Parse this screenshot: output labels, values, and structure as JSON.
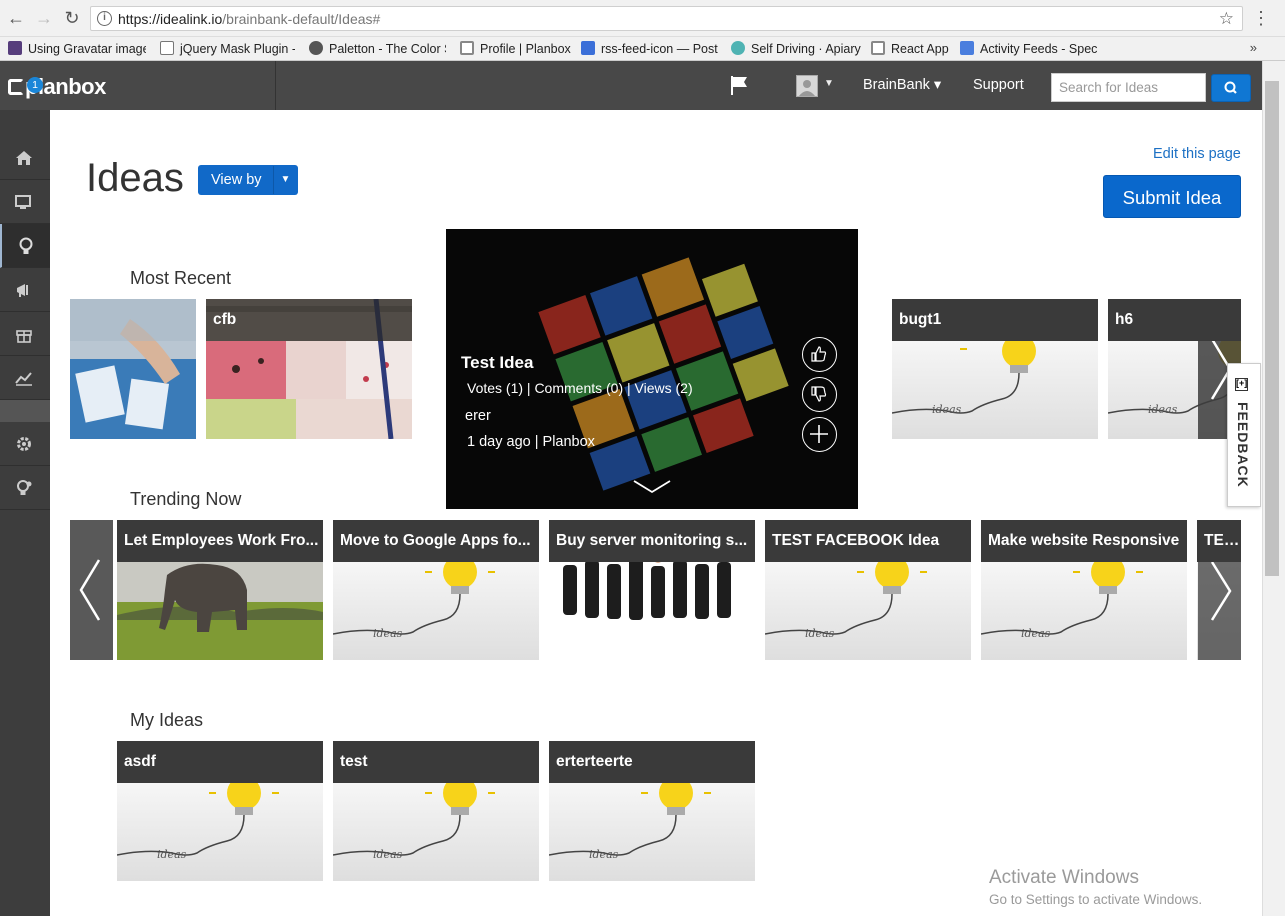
{
  "browser": {
    "url_host": "https://idealink.io",
    "url_path": "/brainbank-default/Ideas#",
    "bookmarks": [
      {
        "label": "Using Gravatar image",
        "icon": "bootstrap-icon",
        "color": "#563d7c"
      },
      {
        "label": "jQuery Mask Plugin -",
        "icon": "page-icon",
        "color": "#ffffff"
      },
      {
        "label": "Paletton - The Color S",
        "icon": "paletton-icon",
        "color": "#555555"
      },
      {
        "label": "Profile | Planbox",
        "icon": "planbox-icon",
        "color": "#888888"
      },
      {
        "label": "rss-feed-icon — Postr",
        "icon": "postr-icon",
        "color": "#3b6fd8"
      },
      {
        "label": "Self Driving · Apiary",
        "icon": "apiary-icon",
        "color": "#4fb3b3"
      },
      {
        "label": "React App",
        "icon": "react-icon",
        "color": "#888888"
      },
      {
        "label": "Activity Feeds - Speci",
        "icon": "docs-icon",
        "color": "#4a7ede"
      }
    ],
    "more": "»"
  },
  "header": {
    "logo": "planbox",
    "brainbank": "BrainBank ▾",
    "support": "Support",
    "search_placeholder": "Search for Ideas"
  },
  "sidebar": {
    "badge_count": "1"
  },
  "main": {
    "title": "Ideas",
    "view_by": "View by",
    "edit_page": "Edit this page",
    "submit_idea": "Submit Idea"
  },
  "sections": {
    "most_recent": "Most Recent",
    "trending": "Trending Now",
    "my_ideas": "My Ideas"
  },
  "most_recent_cards": [
    {
      "title": "cfb"
    },
    {
      "title": "bugt1"
    },
    {
      "title": "h6"
    }
  ],
  "featured": {
    "title": "Test Idea",
    "stats": "Votes (1) | Comments (0) | Views (2)",
    "description": "erer",
    "meta": "1 day ago | Planbox"
  },
  "trending_cards": [
    {
      "title": "Let Employees Work Fro..."
    },
    {
      "title": "Move to Google Apps fo..."
    },
    {
      "title": "Buy server monitoring s..."
    },
    {
      "title": "TEST FACEBOOK Idea"
    },
    {
      "title": "Make website Responsive"
    },
    {
      "title": "TEST"
    }
  ],
  "my_ideas_cards": [
    {
      "title": "asdf"
    },
    {
      "title": "test"
    },
    {
      "title": "erterteerte"
    }
  ],
  "feedback": "FEEDBACK",
  "feedback_icon": "[+]",
  "watermark": {
    "title": "Activate Windows",
    "subtitle": "Go to Settings to activate Windows."
  },
  "colors": {
    "primary": "#0a68cc",
    "header": "#484848",
    "sidebar": "#3d3d3d",
    "link": "#1c70c4"
  }
}
